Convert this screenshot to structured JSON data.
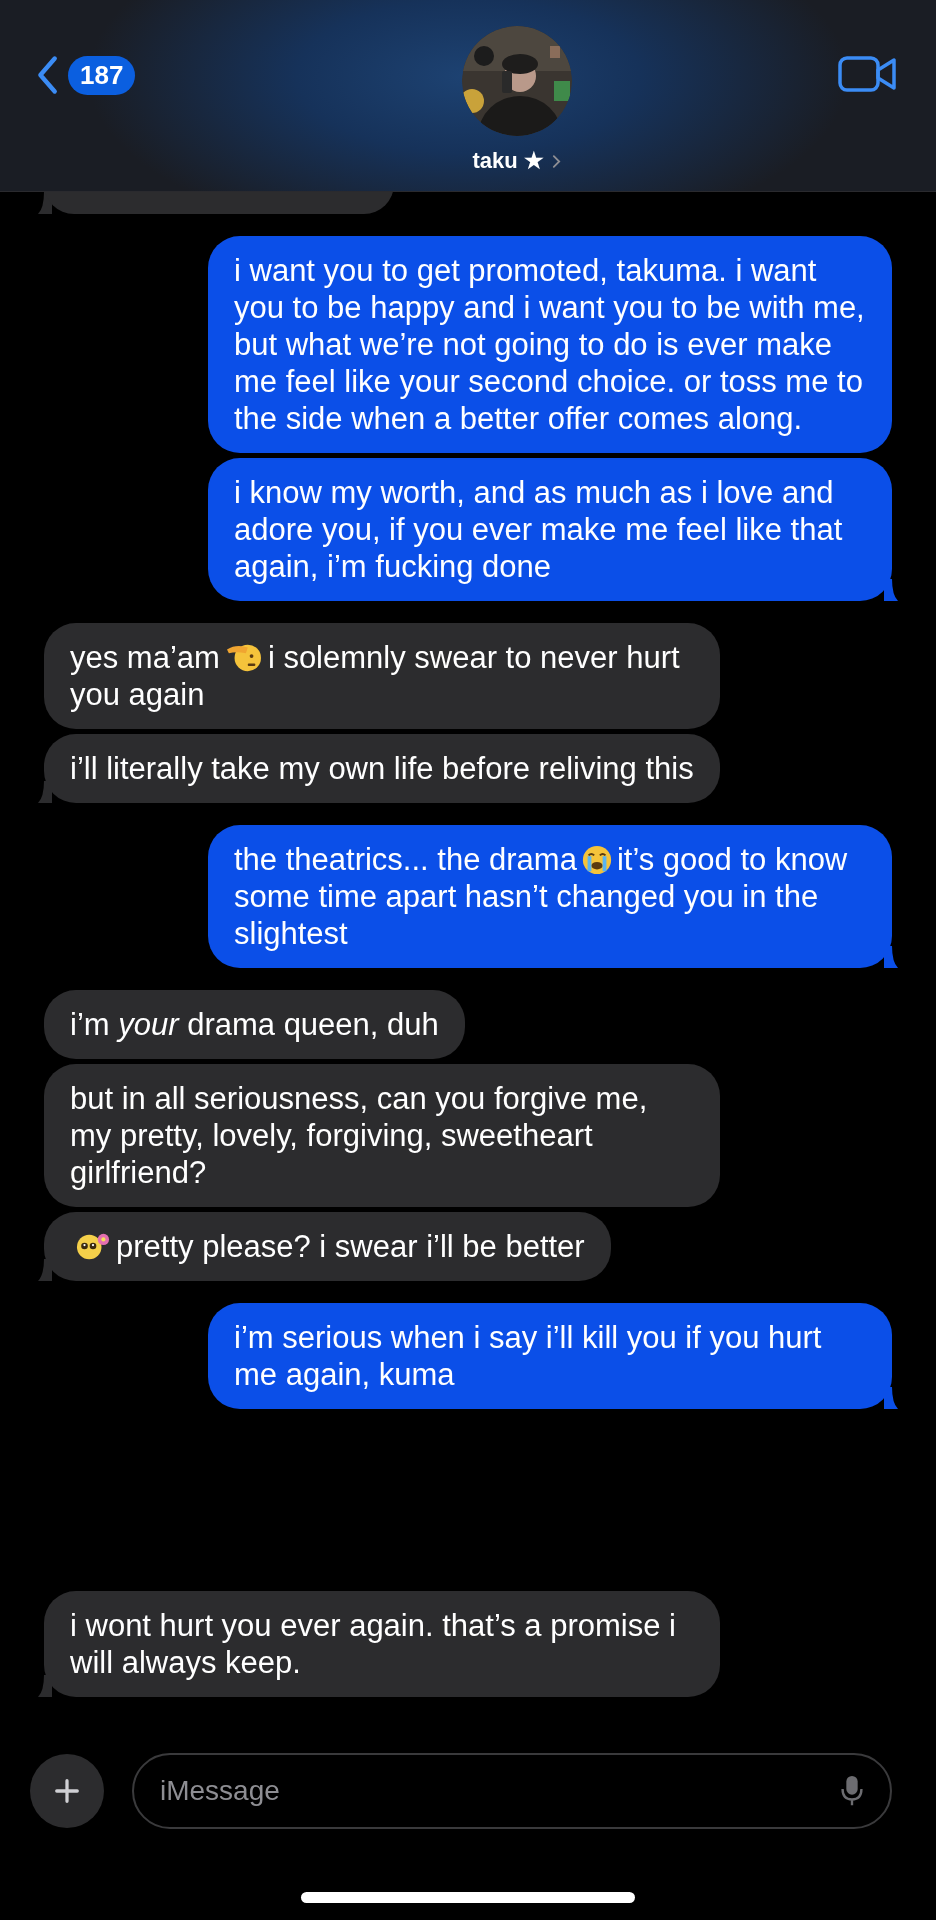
{
  "header": {
    "back_count": "187",
    "contact_name": "taku ★"
  },
  "clipped_message": {
    "outgoing": false,
    "tail": true
  },
  "messages": [
    {
      "outgoing": true,
      "tail": false,
      "parts": [
        {
          "kind": "text",
          "text": "i want you to get promoted, takuma. i want you to be happy and i want you to be with me, but what we’re not going to do is ever make me feel like your second choice. or toss me to the side when a better offer comes along."
        }
      ]
    },
    {
      "outgoing": true,
      "tail": true,
      "parts": [
        {
          "kind": "text",
          "text": "i know my worth, and as much as i love and adore you, if you ever make me feel like that again, i’m fucking done"
        }
      ]
    },
    {
      "outgoing": false,
      "tail": false,
      "parts": [
        {
          "kind": "text",
          "text": "yes ma’am"
        },
        {
          "kind": "salute"
        },
        {
          "kind": "text",
          "text": "i solemnly swear to never hurt you again"
        }
      ]
    },
    {
      "outgoing": false,
      "tail": true,
      "parts": [
        {
          "kind": "text",
          "text": "i’ll literally take my own life before reliving this"
        }
      ]
    },
    {
      "outgoing": true,
      "tail": true,
      "parts": [
        {
          "kind": "text",
          "text": "the theatrics... the drama"
        },
        {
          "kind": "sob"
        },
        {
          "kind": "text",
          "text": "it’s good to know some time apart hasn’t changed you in the slightest"
        }
      ]
    },
    {
      "outgoing": false,
      "tail": false,
      "parts": [
        {
          "kind": "text",
          "text": "i’m *your* drama queen, duh"
        }
      ]
    },
    {
      "outgoing": false,
      "tail": false,
      "parts": [
        {
          "kind": "text",
          "text": "but in all seriousness, can you forgive me, my pretty, lovely, forgiving, sweetheart girlfriend?"
        }
      ]
    },
    {
      "outgoing": false,
      "tail": true,
      "parts": [
        {
          "kind": "pleading"
        },
        {
          "kind": "text",
          "text": "pretty please? i swear i’ll be better"
        }
      ]
    },
    {
      "outgoing": true,
      "tail": true,
      "parts": [
        {
          "kind": "text",
          "text": "i’m serious when i say i’ll kill you if you hurt me again, kuma"
        }
      ]
    },
    {
      "outgoing": false,
      "tail": true,
      "parts": [
        {
          "kind": "text",
          "text": "i wont hurt you ever again. that’s a promise i will always keep."
        }
      ]
    }
  ],
  "composer": {
    "placeholder": "iMessage"
  }
}
